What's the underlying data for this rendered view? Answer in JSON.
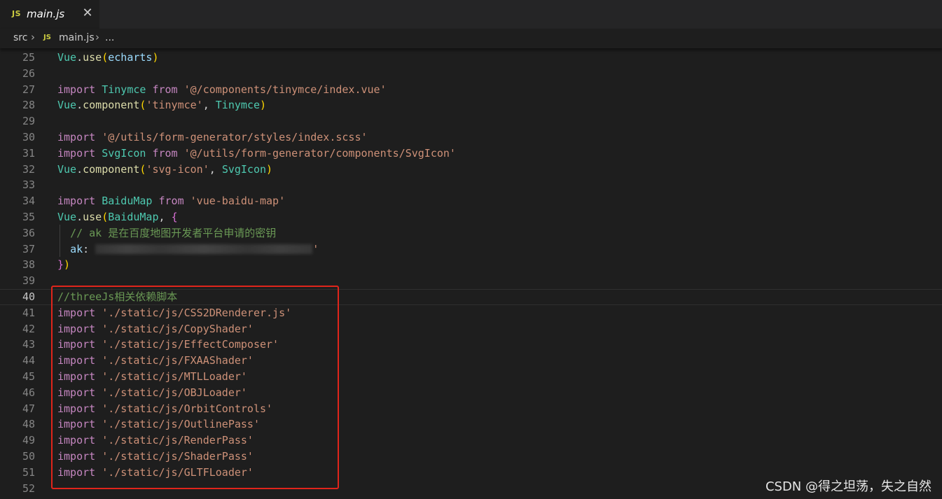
{
  "tab": {
    "icon_text": "JS",
    "label": "main.js",
    "close": "✕"
  },
  "breadcrumb": {
    "folder": "src",
    "separator": "›",
    "file_icon_text": "JS",
    "file": "main.js",
    "more": "..."
  },
  "editor": {
    "current_line": "40",
    "lines": [
      {
        "n": "25",
        "tokens": [
          [
            "cls",
            "Vue"
          ],
          [
            "pl",
            "."
          ],
          [
            "fn",
            "use"
          ],
          [
            "br1",
            "("
          ],
          [
            "vr",
            "echarts"
          ],
          [
            "br1",
            ")"
          ]
        ]
      },
      {
        "n": "26",
        "tokens": []
      },
      {
        "n": "27",
        "tokens": [
          [
            "kw",
            "import"
          ],
          [
            "pl",
            " "
          ],
          [
            "cls",
            "Tinymce"
          ],
          [
            "pl",
            " "
          ],
          [
            "kw",
            "from"
          ],
          [
            "pl",
            " "
          ],
          [
            "str",
            "'@/components/tinymce/index.vue'"
          ]
        ]
      },
      {
        "n": "28",
        "tokens": [
          [
            "cls",
            "Vue"
          ],
          [
            "pl",
            "."
          ],
          [
            "fn",
            "component"
          ],
          [
            "br1",
            "("
          ],
          [
            "str",
            "'tinymce'"
          ],
          [
            "pl",
            ", "
          ],
          [
            "cls",
            "Tinymce"
          ],
          [
            "br1",
            ")"
          ]
        ]
      },
      {
        "n": "29",
        "tokens": []
      },
      {
        "n": "30",
        "tokens": [
          [
            "kw",
            "import"
          ],
          [
            "pl",
            " "
          ],
          [
            "str",
            "'@/utils/form-generator/styles/index.scss'"
          ]
        ]
      },
      {
        "n": "31",
        "tokens": [
          [
            "kw",
            "import"
          ],
          [
            "pl",
            " "
          ],
          [
            "cls",
            "SvgIcon"
          ],
          [
            "pl",
            " "
          ],
          [
            "kw",
            "from"
          ],
          [
            "pl",
            " "
          ],
          [
            "str",
            "'@/utils/form-generator/components/SvgIcon'"
          ]
        ]
      },
      {
        "n": "32",
        "tokens": [
          [
            "cls",
            "Vue"
          ],
          [
            "pl",
            "."
          ],
          [
            "fn",
            "component"
          ],
          [
            "br1",
            "("
          ],
          [
            "str",
            "'svg-icon'"
          ],
          [
            "pl",
            ", "
          ],
          [
            "cls",
            "SvgIcon"
          ],
          [
            "br1",
            ")"
          ]
        ]
      },
      {
        "n": "33",
        "tokens": []
      },
      {
        "n": "34",
        "tokens": [
          [
            "kw",
            "import"
          ],
          [
            "pl",
            " "
          ],
          [
            "cls",
            "BaiduMap"
          ],
          [
            "pl",
            " "
          ],
          [
            "kw",
            "from"
          ],
          [
            "pl",
            " "
          ],
          [
            "str",
            "'vue-baidu-map'"
          ]
        ]
      },
      {
        "n": "35",
        "tokens": [
          [
            "cls",
            "Vue"
          ],
          [
            "pl",
            "."
          ],
          [
            "fn",
            "use"
          ],
          [
            "br1",
            "("
          ],
          [
            "cls",
            "BaiduMap"
          ],
          [
            "pl",
            ", "
          ],
          [
            "br2",
            "{"
          ]
        ]
      },
      {
        "n": "36",
        "tokens": [
          [
            "pl",
            "  "
          ],
          [
            "cm",
            "// ak 是在百度地图开发者平台申请的密钥"
          ]
        ]
      },
      {
        "n": "37",
        "tokens": [
          [
            "pl",
            "  "
          ],
          [
            "vr",
            "ak"
          ],
          [
            "pl",
            ": "
          ],
          [
            "redact",
            ""
          ],
          [
            "str",
            "'"
          ]
        ]
      },
      {
        "n": "38",
        "tokens": [
          [
            "br2",
            "}"
          ],
          [
            "br1",
            ")"
          ]
        ]
      },
      {
        "n": "39",
        "tokens": []
      },
      {
        "n": "40",
        "tokens": [
          [
            "cm",
            "//threeJs相关依赖脚本"
          ]
        ]
      },
      {
        "n": "41",
        "tokens": [
          [
            "kw",
            "import"
          ],
          [
            "pl",
            " "
          ],
          [
            "str",
            "'./static/js/CSS2DRenderer.js'"
          ]
        ]
      },
      {
        "n": "42",
        "tokens": [
          [
            "kw",
            "import"
          ],
          [
            "pl",
            " "
          ],
          [
            "str",
            "'./static/js/CopyShader'"
          ]
        ]
      },
      {
        "n": "43",
        "tokens": [
          [
            "kw",
            "import"
          ],
          [
            "pl",
            " "
          ],
          [
            "str",
            "'./static/js/EffectComposer'"
          ]
        ]
      },
      {
        "n": "44",
        "tokens": [
          [
            "kw",
            "import"
          ],
          [
            "pl",
            " "
          ],
          [
            "str",
            "'./static/js/FXAAShader'"
          ]
        ]
      },
      {
        "n": "45",
        "tokens": [
          [
            "kw",
            "import"
          ],
          [
            "pl",
            " "
          ],
          [
            "str",
            "'./static/js/MTLLoader'"
          ]
        ]
      },
      {
        "n": "46",
        "tokens": [
          [
            "kw",
            "import"
          ],
          [
            "pl",
            " "
          ],
          [
            "str",
            "'./static/js/OBJLoader'"
          ]
        ]
      },
      {
        "n": "47",
        "tokens": [
          [
            "kw",
            "import"
          ],
          [
            "pl",
            " "
          ],
          [
            "str",
            "'./static/js/OrbitControls'"
          ]
        ]
      },
      {
        "n": "48",
        "tokens": [
          [
            "kw",
            "import"
          ],
          [
            "pl",
            " "
          ],
          [
            "str",
            "'./static/js/OutlinePass'"
          ]
        ]
      },
      {
        "n": "49",
        "tokens": [
          [
            "kw",
            "import"
          ],
          [
            "pl",
            " "
          ],
          [
            "str",
            "'./static/js/RenderPass'"
          ]
        ]
      },
      {
        "n": "50",
        "tokens": [
          [
            "kw",
            "import"
          ],
          [
            "pl",
            " "
          ],
          [
            "str",
            "'./static/js/ShaderPass'"
          ]
        ]
      },
      {
        "n": "51",
        "tokens": [
          [
            "kw",
            "import"
          ],
          [
            "pl",
            " "
          ],
          [
            "str",
            "'./static/js/GLTFLoader'"
          ]
        ]
      },
      {
        "n": "52",
        "tokens": []
      }
    ]
  },
  "watermark": "CSDN @得之坦荡，失之自然",
  "colors": {
    "keyword": "#c586c0",
    "string": "#ce9178",
    "comment": "#6a9955",
    "class": "#4ec9b0",
    "function": "#dcdcaa",
    "variable": "#9cdcfe",
    "highlight_box": "#e0251b"
  }
}
